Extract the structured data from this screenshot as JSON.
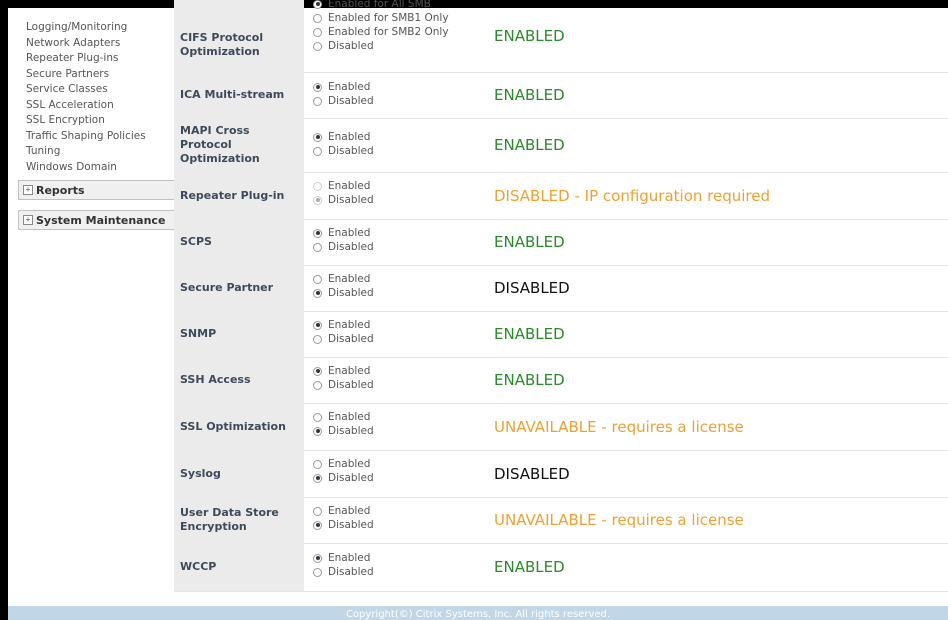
{
  "colors": {
    "enabled": "#2a8a2a",
    "warning": "#f0a030",
    "disabled": "#111111"
  },
  "sidebar": {
    "links": [
      "Logging/Monitoring",
      "Network Adapters",
      "Repeater Plug-ins",
      "Secure Partners",
      "Service Classes",
      "SSL Acceleration",
      "SSL Encryption",
      "Traffic Shaping Policies",
      "Tuning",
      "Windows Domain"
    ],
    "sections": [
      {
        "label": "Reports",
        "icon": "plus-icon"
      },
      {
        "label": "System Maintenance",
        "icon": "plus-icon"
      }
    ]
  },
  "rows": [
    {
      "name": "CIFS Protocol Optimization",
      "status": "ENABLED",
      "kind": "enabled",
      "options": [
        {
          "label": "Enabled for All SMB",
          "selected": true
        },
        {
          "label": "Enabled for SMB1 Only",
          "selected": false
        },
        {
          "label": "Enabled for SMB2 Only",
          "selected": false
        },
        {
          "label": "Disabled",
          "selected": false
        }
      ]
    },
    {
      "name": "ICA Multi-stream",
      "status": "ENABLED",
      "kind": "enabled",
      "options": [
        {
          "label": "Enabled",
          "selected": true
        },
        {
          "label": "Disabled",
          "selected": false
        }
      ]
    },
    {
      "name": "MAPI Cross Protocol Optimization",
      "status": "ENABLED",
      "kind": "enabled",
      "options": [
        {
          "label": "Enabled",
          "selected": true
        },
        {
          "label": "Disabled",
          "selected": false
        }
      ]
    },
    {
      "name": "Repeater Plug-in",
      "status": "DISABLED - IP configuration required",
      "kind": "warning",
      "inactive": true,
      "options": [
        {
          "label": "Enabled",
          "selected": false
        },
        {
          "label": "Disabled",
          "selected": true
        }
      ]
    },
    {
      "name": "SCPS",
      "status": "ENABLED",
      "kind": "enabled",
      "options": [
        {
          "label": "Enabled",
          "selected": true
        },
        {
          "label": "Disabled",
          "selected": false
        }
      ]
    },
    {
      "name": "Secure Partner",
      "status": "DISABLED",
      "kind": "disabled",
      "options": [
        {
          "label": "Enabled",
          "selected": false
        },
        {
          "label": "Disabled",
          "selected": true
        }
      ]
    },
    {
      "name": "SNMP",
      "status": "ENABLED",
      "kind": "enabled",
      "options": [
        {
          "label": "Enabled",
          "selected": true
        },
        {
          "label": "Disabled",
          "selected": false
        }
      ]
    },
    {
      "name": "SSH Access",
      "status": "ENABLED",
      "kind": "enabled",
      "options": [
        {
          "label": "Enabled",
          "selected": true
        },
        {
          "label": "Disabled",
          "selected": false
        }
      ]
    },
    {
      "name": "SSL Optimization",
      "status": "UNAVAILABLE - requires a license",
      "kind": "warning",
      "options": [
        {
          "label": "Enabled",
          "selected": false
        },
        {
          "label": "Disabled",
          "selected": true
        }
      ]
    },
    {
      "name": "Syslog",
      "status": "DISABLED",
      "kind": "disabled",
      "options": [
        {
          "label": "Enabled",
          "selected": false
        },
        {
          "label": "Disabled",
          "selected": true
        }
      ]
    },
    {
      "name": "User Data Store Encryption",
      "status": "UNAVAILABLE - requires a license",
      "kind": "warning",
      "options": [
        {
          "label": "Enabled",
          "selected": false
        },
        {
          "label": "Disabled",
          "selected": true
        }
      ]
    },
    {
      "name": "WCCP",
      "status": "ENABLED",
      "kind": "enabled",
      "options": [
        {
          "label": "Enabled",
          "selected": true
        },
        {
          "label": "Disabled",
          "selected": false
        }
      ]
    }
  ],
  "footer": {
    "text": "Copyright(©) Citrix Systems, Inc. All rights reserved."
  }
}
